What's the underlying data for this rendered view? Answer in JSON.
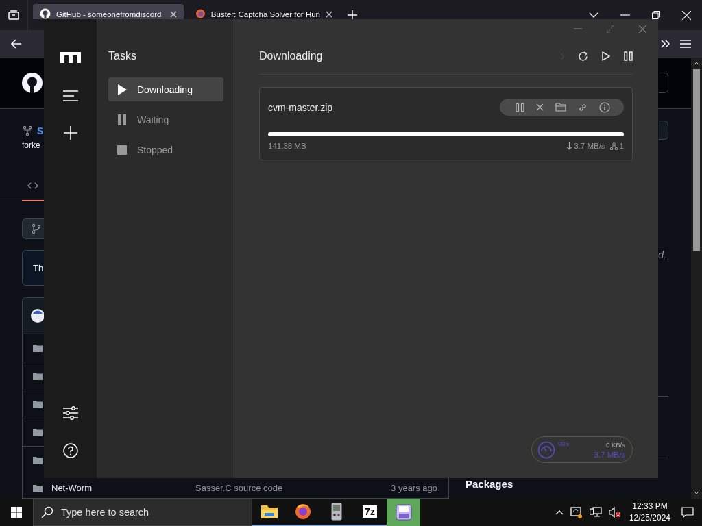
{
  "browser": {
    "tabs": [
      {
        "title": "GitHub - someonefromdiscord",
        "kind": "github",
        "selected": true
      },
      {
        "title": "Buster: Captcha Solver for Hun",
        "kind": "addon",
        "selected": false
      }
    ]
  },
  "github": {
    "repo_letter": "S",
    "forked": "forke",
    "about_start": "Th",
    "last_row": {
      "name": "Net-Worm",
      "message": "Sasser.C source code",
      "age": "3 years ago"
    },
    "side_text": "d.",
    "packages": "Packages"
  },
  "motrix": {
    "sidebar_title": "Tasks",
    "nav": [
      {
        "label": "Downloading",
        "kind": "play",
        "selected": true
      },
      {
        "label": "Waiting",
        "kind": "pause",
        "selected": false
      },
      {
        "label": "Stopped",
        "kind": "stop",
        "selected": false
      }
    ],
    "heading": "Downloading",
    "tasks": [
      {
        "name": "cvm-master.zip",
        "level": 1,
        "size": "141.38 MB",
        "speed": "3.7 MB/s",
        "connections": "1"
      }
    ],
    "speedometer": {
      "unit": "MB/s",
      "upload": "0 KB/s",
      "download": "3.7 MB/s"
    }
  },
  "taskbar": {
    "search_placeholder": "Type here to search",
    "apps": [
      {
        "kind": "explorer",
        "selected": false
      },
      {
        "kind": "firefox",
        "selected": false
      },
      {
        "kind": "handheld",
        "selected": false
      },
      {
        "kind": "archiver",
        "label": "7z",
        "selected": false
      },
      {
        "kind": "floppy",
        "selected": true
      }
    ],
    "time": "12:33 PM",
    "date": "12/25/2024"
  }
}
